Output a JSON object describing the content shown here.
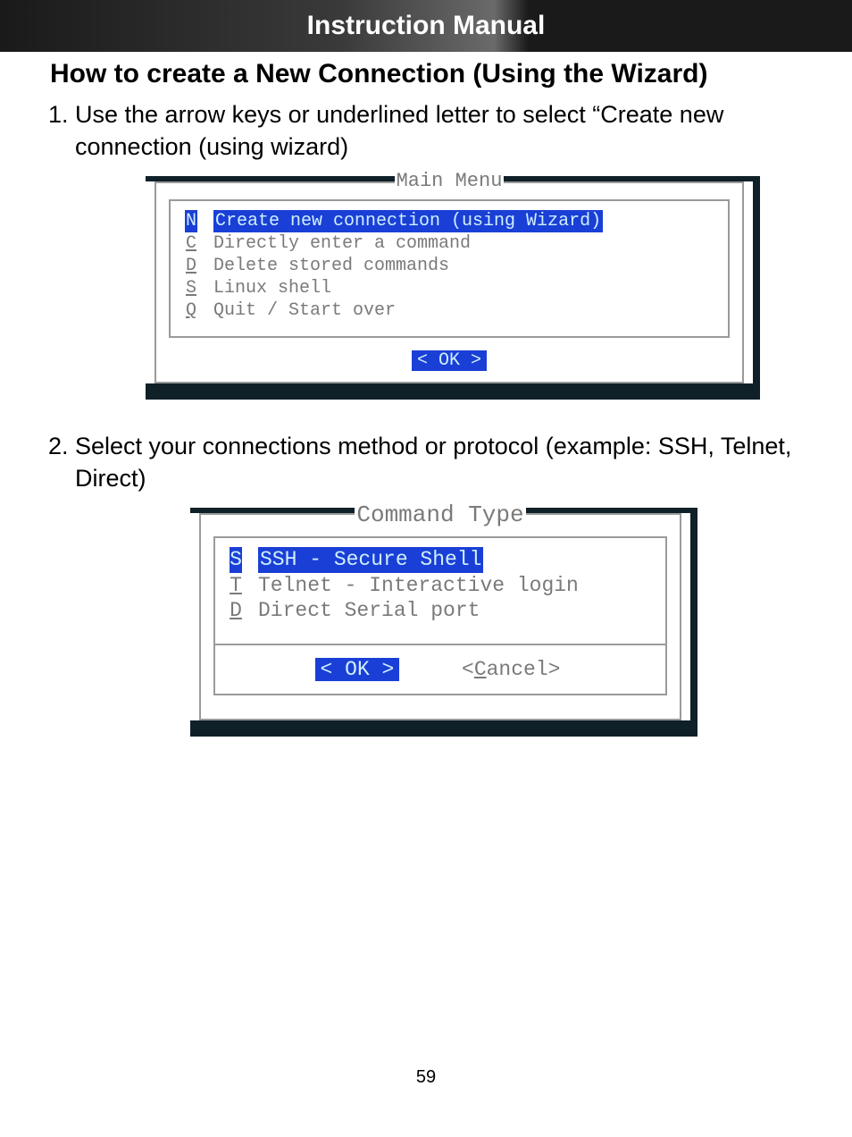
{
  "header": {
    "title": "Instruction Manual"
  },
  "section": {
    "title": "How to create a New Connection (Using the Wizard)"
  },
  "steps": {
    "s1": "Use the arrow keys or underlined letter to select “Create new connection (using wizard)",
    "s2": "Select your connections method or protocol (example: SSH, Telnet, Direct)"
  },
  "mainMenu": {
    "title": "Main Menu",
    "items": [
      {
        "key": "N",
        "label": "Create new connection (using Wizard)",
        "selected": true
      },
      {
        "key": "C",
        "label": "Directly enter a command",
        "selected": false
      },
      {
        "key": "D",
        "label": "Delete stored commands",
        "selected": false
      },
      {
        "key": "S",
        "label": "Linux shell",
        "selected": false
      },
      {
        "key": "Q",
        "label": "Quit / Start over",
        "selected": false
      }
    ],
    "ok": "<  OK  >"
  },
  "cmdType": {
    "title": "Command Type",
    "items": [
      {
        "key": "S",
        "label": "SSH - Secure Shell",
        "selected": true
      },
      {
        "key": "T",
        "label": "Telnet - Interactive login",
        "selected": false
      },
      {
        "key": "D",
        "label": "Direct Serial port",
        "selected": false
      }
    ],
    "ok": "<  OK  >",
    "cancelPrefix": "<",
    "cancelHot": "C",
    "cancelRest": "ancel>"
  },
  "page": {
    "number": "59"
  }
}
